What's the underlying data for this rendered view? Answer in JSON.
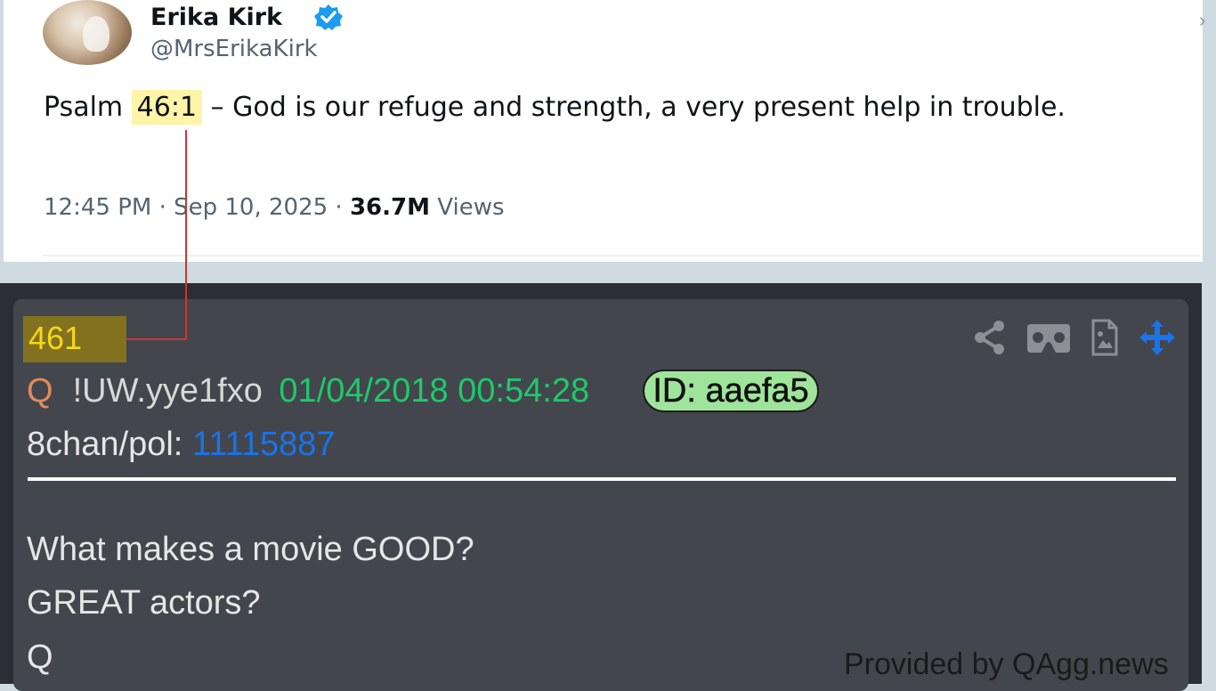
{
  "tweet": {
    "author_name": "Erika Kirk",
    "handle": "@MrsErikaKirk",
    "text_before": "Psalm ",
    "highlight": "46:1",
    "text_after": " – God is our refuge and strength, a very present help in trouble.",
    "time": "12:45 PM",
    "date": "Sep 10, 2025",
    "views_count": "36.7M",
    "views_label": "Views",
    "verified_color": "#1d9bf0"
  },
  "qpost": {
    "number": "461",
    "author": "Q",
    "tripcode": "!UW.yye1fxo",
    "datetime": "01/04/2018 00:54:28",
    "id_badge": "ID: aaefa5",
    "board_label": "8chan/pol:",
    "board_post": "11115887",
    "lines": [
      "What makes a movie GOOD?",
      "GREAT actors?",
      "Q"
    ],
    "credit": "Provided by QAgg.news",
    "icons": [
      "share-icon",
      "vr-headset-icon",
      "image-file-icon",
      "move-arrows-icon"
    ]
  },
  "colors": {
    "highlight": "#fff4a8",
    "connector": "#d0342c",
    "qnum_bg": "#827220",
    "qnum_text": "#f6d71a",
    "date": "#1ec96a",
    "link": "#1a73e8",
    "id_badge": "#9ee49a"
  }
}
